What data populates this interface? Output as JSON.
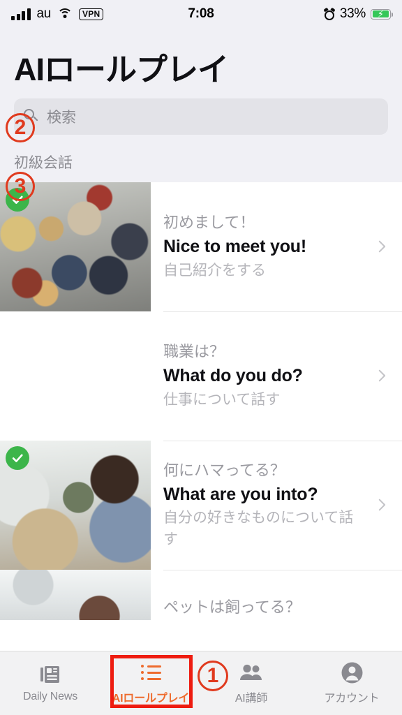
{
  "status_bar": {
    "carrier": "au",
    "vpn_badge": "VPN",
    "time": "7:08",
    "battery_percent": "33%",
    "icons": [
      "signal-bars-icon",
      "wifi-icon",
      "vpn-badge",
      "alarm-icon",
      "battery-charging-icon"
    ]
  },
  "header": {
    "title": "AIロールプレイ"
  },
  "search": {
    "placeholder": "検索",
    "value": ""
  },
  "section": {
    "title": "初級会話"
  },
  "lessons": [
    {
      "ja_title": "初めまして！",
      "en_title": "Nice to meet you!",
      "subtitle": "自己紹介をする",
      "completed": true,
      "thumb": "networking-crowd-photo"
    },
    {
      "ja_title": "職業は？",
      "en_title": "What do you do?",
      "subtitle": "仕事について話す",
      "completed": false,
      "thumb": "outdoor-gathering-photo"
    },
    {
      "ja_title": "何にハマってる？",
      "en_title": "What are you into?",
      "subtitle": "自分の好きなものについて話す",
      "completed": true,
      "thumb": "record-store-photo"
    },
    {
      "ja_title": "ペットは飼ってる？",
      "en_title": "",
      "subtitle": "",
      "completed": false,
      "thumb": "home-interior-photo"
    }
  ],
  "tabs": [
    {
      "label": "Daily News",
      "icon": "newspaper-icon",
      "active": false
    },
    {
      "label": "AIロールプレイ",
      "icon": "list-icon",
      "active": true
    },
    {
      "label": "AI講師",
      "icon": "people-icon",
      "active": false
    },
    {
      "label": "アカウント",
      "icon": "person-circle-icon",
      "active": false
    }
  ],
  "annotations": [
    {
      "id": "1",
      "target": "tab-ai-teacher"
    },
    {
      "id": "2",
      "target": "search-input"
    },
    {
      "id": "3",
      "target": "section-title"
    }
  ],
  "colors": {
    "accent": "#ee6b2d",
    "annotation": "#e03a1e",
    "annotation_rect": "#ee1c10",
    "completed_badge": "#3cb54a",
    "header_bg": "#f0f0f5",
    "search_bg": "#e3e3e8",
    "tabbar_bg": "#f2f2f3"
  }
}
